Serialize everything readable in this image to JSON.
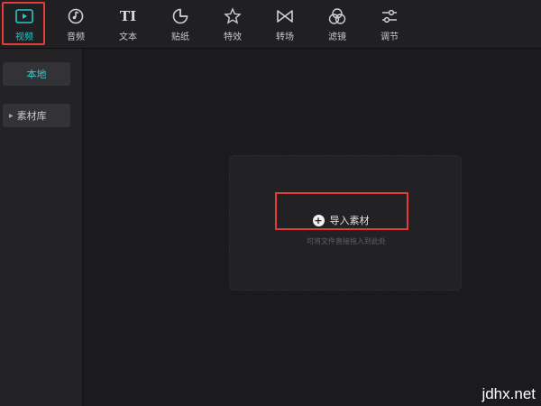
{
  "toolbar": {
    "tools": [
      {
        "label": "视频",
        "icon": "video-play-icon",
        "active": true
      },
      {
        "label": "音频",
        "icon": "audio-note-icon"
      },
      {
        "label": "文本",
        "icon": "text-ti-icon",
        "glyph": "TI"
      },
      {
        "label": "贴纸",
        "icon": "sticker-icon"
      },
      {
        "label": "特效",
        "icon": "effects-star-icon"
      },
      {
        "label": "转场",
        "icon": "transition-bowtie-icon"
      },
      {
        "label": "滤镜",
        "icon": "filter-circles-icon"
      },
      {
        "label": "调节",
        "icon": "adjust-sliders-icon"
      }
    ]
  },
  "sidebar": {
    "local_label": "本地",
    "library_label": "素材库"
  },
  "main": {
    "import_label": "导入素材",
    "hint": "可将文件直接拖入到此处"
  },
  "watermark": "jdhx.net",
  "colors": {
    "accent": "#22c9c9",
    "highlight": "#e53b3b",
    "background": "#1b1b1e"
  }
}
